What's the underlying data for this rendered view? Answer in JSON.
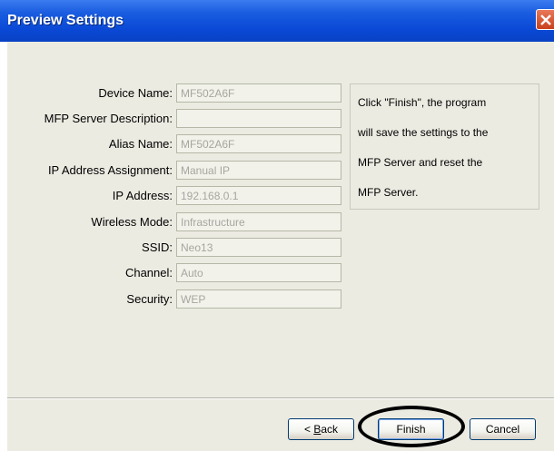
{
  "window": {
    "title": "Preview Settings"
  },
  "form": {
    "rows": [
      {
        "label": "Device Name:",
        "value": "MF502A6F"
      },
      {
        "label": "MFP Server Description:",
        "value": ""
      },
      {
        "label": "Alias Name:",
        "value": "MF502A6F"
      },
      {
        "label": "IP Address Assignment:",
        "value": "Manual IP"
      },
      {
        "label": "IP Address:",
        "value": "192.168.0.1"
      },
      {
        "label": "Wireless Mode:",
        "value": "Infrastructure"
      },
      {
        "label": "SSID:",
        "value": "Neo13"
      },
      {
        "label": "Channel:",
        "value": "Auto"
      },
      {
        "label": "Security:",
        "value": "WEP"
      }
    ]
  },
  "info": {
    "lines": [
      "Click \"Finish\", the program",
      "will save the settings to the",
      "MFP Server and reset the",
      "MFP Server."
    ]
  },
  "buttons": {
    "back_prefix": "< ",
    "back_mnemonic": "B",
    "back_rest": "ack",
    "finish": "Finish",
    "cancel": "Cancel"
  },
  "colors": {
    "titlebar": "#0a49d6",
    "dialog_bg": "#ecebe2",
    "field_text": "#a6a6a0",
    "button_border": "#003c74"
  }
}
